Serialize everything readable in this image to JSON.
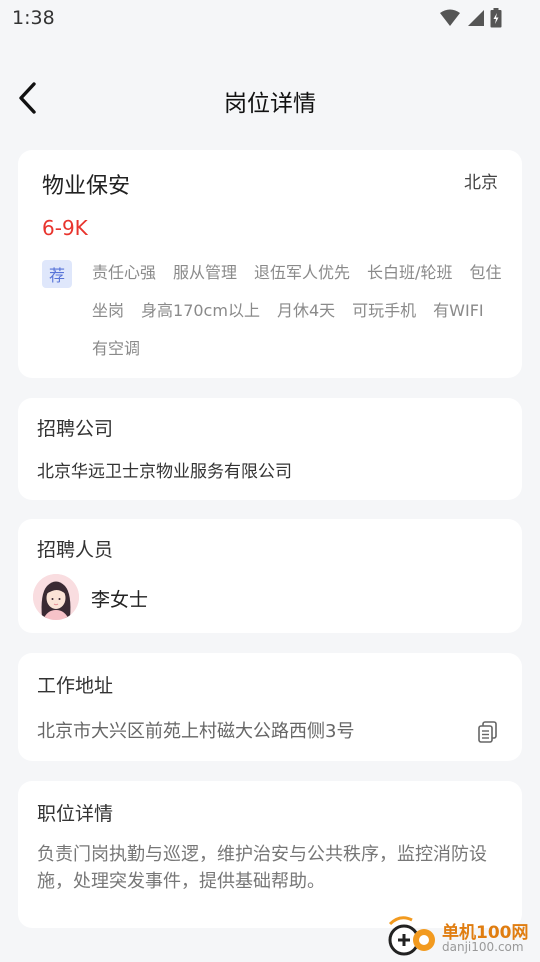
{
  "status_bar": {
    "time": "1:38"
  },
  "header": {
    "title": "岗位详情",
    "back_icon": "chevron-left-icon"
  },
  "job": {
    "title": "物业保安",
    "city": "北京",
    "salary": "6-9K",
    "recommend_badge": "荐",
    "tags": [
      "责任心强",
      "服从管理",
      "退伍军人优先",
      "长白班/轮班",
      "包住",
      "坐岗",
      "身高170cm以上",
      "月休4天",
      "可玩手机",
      "有WIFI",
      "有空调"
    ]
  },
  "company": {
    "section_title": "招聘公司",
    "name": "北京华远卫士京物业服务有限公司"
  },
  "recruiter": {
    "section_title": "招聘人员",
    "name": "李女士"
  },
  "address": {
    "section_title": "工作地址",
    "text": "北京市大兴区前苑上村磁大公路西侧3号",
    "copy_icon": "copy-icon"
  },
  "description": {
    "section_title": "职位详情",
    "text": "负责门岗执勤与巡逻，维护治安与公共秩序，监控消防设施，处理突发事件，提供基础帮助。"
  },
  "watermark": {
    "name": "单机100网",
    "url": "danji100.com"
  },
  "colors": {
    "background": "#f5f6f8",
    "card": "#ffffff",
    "salary": "#e8342d",
    "badge_bg": "#dfe7fb",
    "badge_text": "#5874d8",
    "tag_text": "#8a8a8a"
  }
}
